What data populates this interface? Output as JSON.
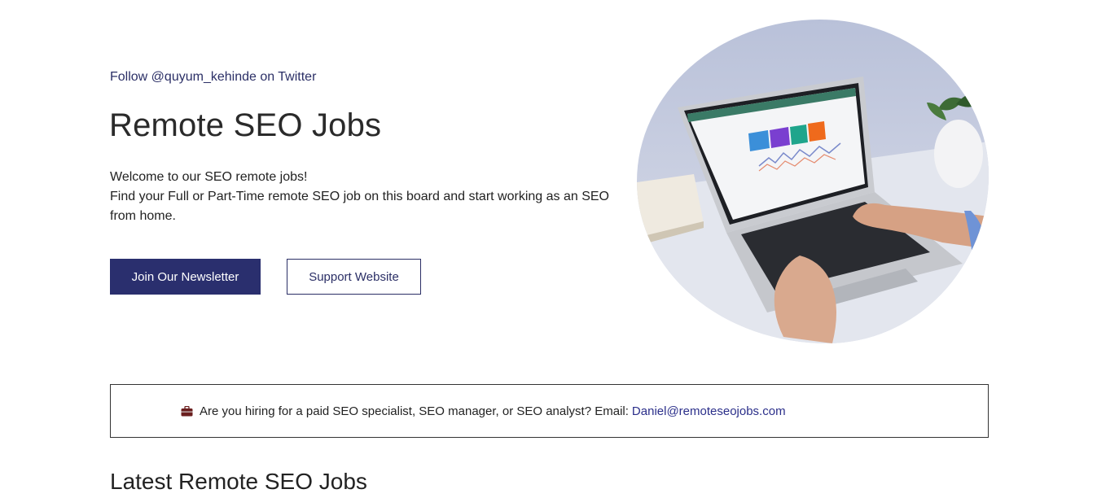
{
  "header": {
    "follow_link": "Follow @quyum_kehinde on Twitter",
    "title": "Remote SEO Jobs",
    "intro_line1": "Welcome to our SEO remote jobs!",
    "intro_line2": "Find your Full or Part-Time remote SEO job on this board and start working as an SEO from home."
  },
  "buttons": {
    "newsletter": "Join Our Newsletter",
    "support": "Support Website"
  },
  "banner": {
    "icon": "briefcase-icon",
    "text": "Are you hiring for a paid SEO specialist, SEO manager, or SEO analyst? Email:",
    "email": "Daniel@remoteseojobs.com"
  },
  "section": {
    "latest_title": "Latest Remote SEO Jobs"
  },
  "colors": {
    "accent": "#2a2f6e",
    "link": "#2b2f8a"
  }
}
